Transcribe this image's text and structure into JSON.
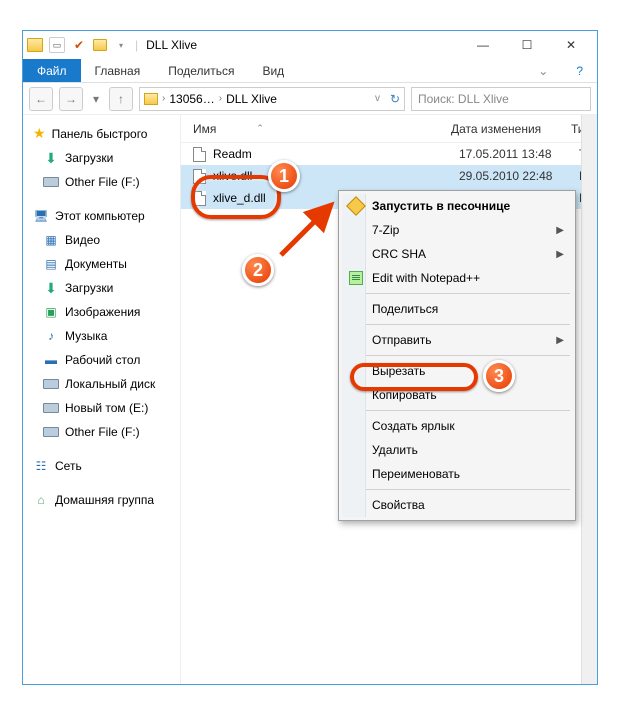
{
  "window": {
    "title": "DLL Xlive"
  },
  "ribbon": {
    "file": "Файл",
    "tabs": [
      "Главная",
      "Поделиться",
      "Вид"
    ]
  },
  "address": {
    "crumbs": [
      "13056…",
      "DLL Xlive"
    ],
    "search_placeholder": "Поиск: DLL Xlive"
  },
  "nav": {
    "quick": "Панель быстрого",
    "downloads": "Загрузки",
    "otherfile": "Other File (F:)",
    "thispc": "Этот компьютер",
    "videos": "Видео",
    "documents": "Документы",
    "downloads2": "Загрузки",
    "pictures": "Изображения",
    "music": "Музыка",
    "desktop": "Рабочий стол",
    "localdisk": "Локальный диск",
    "newvol": "Новый том (E:)",
    "otherfile2": "Other File (F:)",
    "network": "Сеть",
    "homegroup": "Домашняя группа"
  },
  "columns": {
    "name": "Имя",
    "date": "Дата изменения",
    "type": "Ти"
  },
  "files": [
    {
      "name": "Readm",
      "date": "17.05.2011 13:48",
      "type": "Те",
      "sel": false
    },
    {
      "name": "xlive.dll",
      "date": "29.05.2010 22:48",
      "type": "Ра",
      "sel": true
    },
    {
      "name": "xlive_d.dll",
      "date": "",
      "type": "Ра",
      "sel": true
    }
  ],
  "context": {
    "sandbox": "Запустить в песочнице",
    "sevenzip": "7-Zip",
    "crcsha": "CRC SHA",
    "npp": "Edit with Notepad++",
    "share": "Поделиться",
    "sendto": "Отправить",
    "cut": "Вырезать",
    "copy": "Копировать",
    "shortcut": "Создать ярлык",
    "delete": "Удалить",
    "rename": "Переименовать",
    "properties": "Свойства"
  },
  "callouts": {
    "c1": "1",
    "c2": "2",
    "c3": "3"
  }
}
